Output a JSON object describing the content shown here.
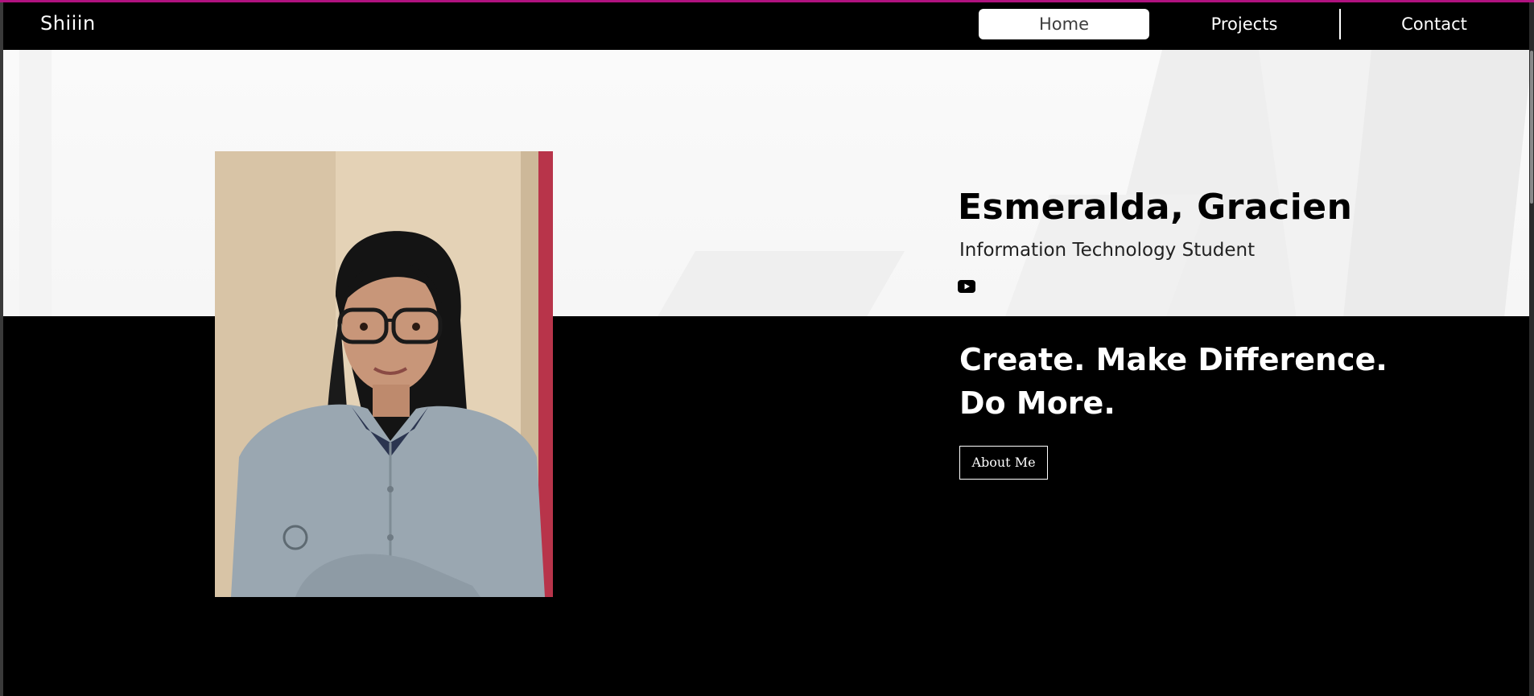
{
  "header": {
    "logo": "Shiiin",
    "nav": [
      {
        "label": "Home",
        "active": true
      },
      {
        "label": "Projects",
        "active": false
      },
      {
        "label": "Contact",
        "active": false
      }
    ]
  },
  "hero": {
    "name": "Esmeralda, Gracien",
    "subtitle": "Information Technology Student",
    "social_icon": "youtube-icon",
    "tagline_line1": "Create. Make Difference.",
    "tagline_line2": "Do More.",
    "about_button": "About Me"
  },
  "colors": {
    "accent": "#b0127f",
    "dark_bg": "#000000",
    "light_bg": "#f8f8f8",
    "text_light": "#ffffff",
    "text_dark": "#000000"
  }
}
